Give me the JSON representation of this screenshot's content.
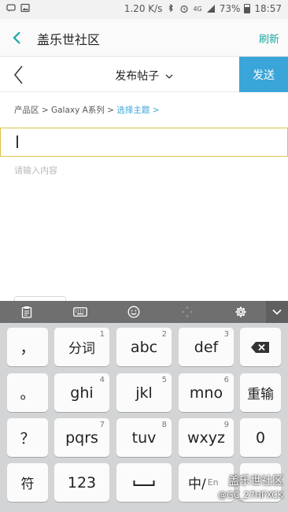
{
  "status_bar": {
    "speed": "1.20 K/s",
    "battery_percent": "73%",
    "time": "18:57",
    "icons": [
      "message-icon",
      "image-icon",
      "bluetooth-icon",
      "alarm-icon",
      "4g-icon",
      "signal-icon",
      "battery-icon"
    ]
  },
  "app_bar": {
    "back_icon": "chevron-left-icon",
    "title": "盖乐世社区",
    "refresh_label": "刷新"
  },
  "post_toolbar": {
    "back_icon": "chevron-left-icon",
    "title": "发布帖子",
    "title_dropdown_icon": "chevron-down-icon",
    "send_label": "发送"
  },
  "breadcrumb": {
    "path": "产品区 > Galaxy A系列 > ",
    "topic": "选择主题",
    "arrow": ">"
  },
  "editor": {
    "title_value": "",
    "content_placeholder": "请输入内容"
  },
  "keyboard": {
    "toolbar_icons": [
      "clipboard-icon",
      "keyboard-icon",
      "emoji-icon",
      "cursor-move-icon",
      "settings-icon",
      "collapse-icon"
    ],
    "rows": [
      [
        {
          "label": "，",
          "sub": ""
        },
        {
          "label": "分词",
          "sub": "1"
        },
        {
          "label": "abc",
          "sub": "2"
        },
        {
          "label": "def",
          "sub": "3"
        },
        {
          "label": "⌫",
          "sub": ""
        }
      ],
      [
        {
          "label": "。",
          "sub": ""
        },
        {
          "label": "ghi",
          "sub": "4"
        },
        {
          "label": "jkl",
          "sub": "5"
        },
        {
          "label": "mno",
          "sub": "6"
        },
        {
          "label": "重输",
          "sub": ""
        }
      ],
      [
        {
          "label": "？",
          "sub": ""
        },
        {
          "label": "pqrs",
          "sub": "7"
        },
        {
          "label": "tuv",
          "sub": "8"
        },
        {
          "label": "wxyz",
          "sub": "9"
        },
        {
          "label": "0",
          "sub": ""
        }
      ],
      [
        {
          "label": "符",
          "sub": ""
        },
        {
          "label": "123",
          "sub": ""
        },
        {
          "label": "␣",
          "sub": ""
        },
        {
          "label": "中/",
          "sub": "En"
        },
        {
          "label": "",
          "sub": ""
        }
      ]
    ]
  },
  "watermark": {
    "line1": "盖乐世社区",
    "line2": "@GC_27HFXCK"
  },
  "colors": {
    "accent_teal": "#18a8a0",
    "send_blue": "#3aa5d9",
    "title_border": "#e0c14a"
  }
}
